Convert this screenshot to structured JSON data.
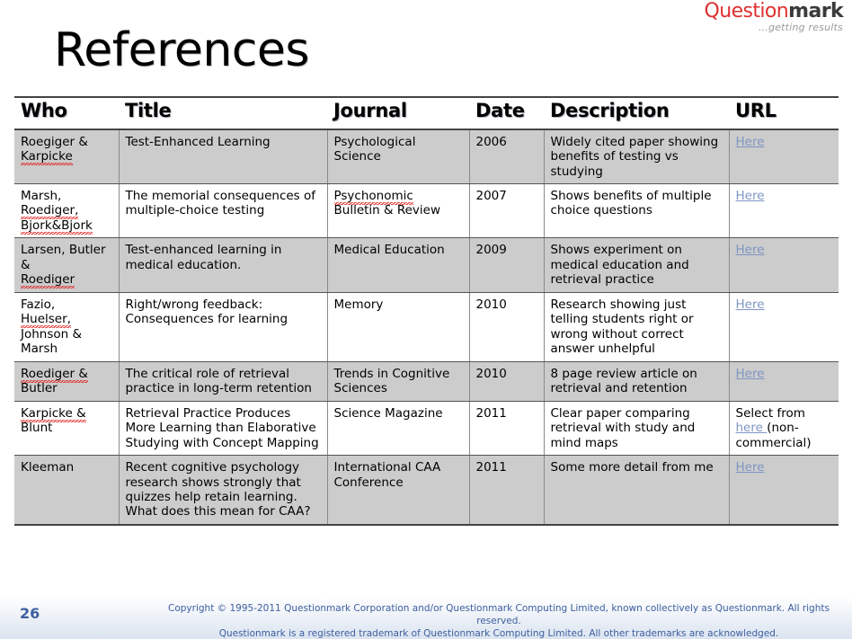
{
  "logo": {
    "brand_part1": "Question",
    "brand_part2": "mark",
    "tagline": "...getting results",
    "color_primary": "#e03030",
    "color_secondary": "#3a3a3a"
  },
  "slide": {
    "title": "References",
    "page_number": "26"
  },
  "table": {
    "headers": {
      "who": "Who",
      "title": "Title",
      "journal": "Journal",
      "date": "Date",
      "description": "Description",
      "url": "URL"
    },
    "rows": [
      {
        "who_plain": "Roegiger &",
        "who_mis1": "Karpicke",
        "title": "Test-Enhanced Learning",
        "journal": "Psychological Science",
        "date": "2006",
        "description": "Widely cited paper showing benefits of testing vs studying",
        "url_label": "Here",
        "shaded": true
      },
      {
        "who_plain": "Marsh,",
        "who_mis1": "Roediger,",
        "who_mis2": "Bjork&Bjork",
        "title": "The memorial consequences of multiple-choice testing",
        "journal_mis": "Psychonomic",
        "journal_rest": "Bulletin & Review",
        "date": "2007",
        "description": "Shows benefits of multiple choice questions",
        "url_label": "Here",
        "shaded": false
      },
      {
        "who_plain": "Larsen, Butler &",
        "who_mis1": "Roediger",
        "title": "Test-enhanced learning in medical education.",
        "journal": "Medical Education",
        "date": "2009",
        "description": "Shows experiment on medical education and retrieval practice",
        "url_label": "Here",
        "shaded": true
      },
      {
        "who_plain": "Fazio,",
        "who_mis1": "Huelser,",
        "who_tail": "Johnson & Marsh",
        "title": "Right/wrong feedback: Consequences for learning",
        "journal": "Memory",
        "date": "2010",
        "description": "Research showing just telling students right or wrong without correct answer unhelpful",
        "url_label": "Here",
        "shaded": false
      },
      {
        "who_mis1": "Roediger &",
        "who_tail": "Butler",
        "title": "The critical role of retrieval practice in long-term retention",
        "journal": "Trends in Cognitive Sciences",
        "date": "2010",
        "description": "8 page review article on retrieval and retention",
        "url_label": "Here ",
        "shaded": true
      },
      {
        "who_mis1": "Karpicke &",
        "who_tail": "Blunt",
        "title": "Retrieval Practice Produces More Learning than Elaborative Studying with Concept Mapping",
        "journal": "Science Magazine",
        "date": "2011",
        "description": "Clear paper comparing retrieval with study and mind maps",
        "url_prefix": "Select from ",
        "url_label": "here ",
        "url_suffix": "(non-commercial)",
        "shaded": false
      },
      {
        "who_plain": "Kleeman",
        "title": "Recent cognitive psychology research shows strongly that quizzes help retain learning. What does this mean for CAA?",
        "journal": "International CAA Conference",
        "date": "2011",
        "description": "Some more detail from me",
        "url_label": "Here",
        "shaded": true
      }
    ]
  },
  "footer": {
    "line1": "Copyright © 1995-2011 Questionmark Corporation and/or Questionmark Computing Limited, known collectively as Questionmark. All rights reserved.",
    "line2": "Questionmark is a registered trademark of Questionmark Computing Limited. All other trademarks are acknowledged."
  }
}
